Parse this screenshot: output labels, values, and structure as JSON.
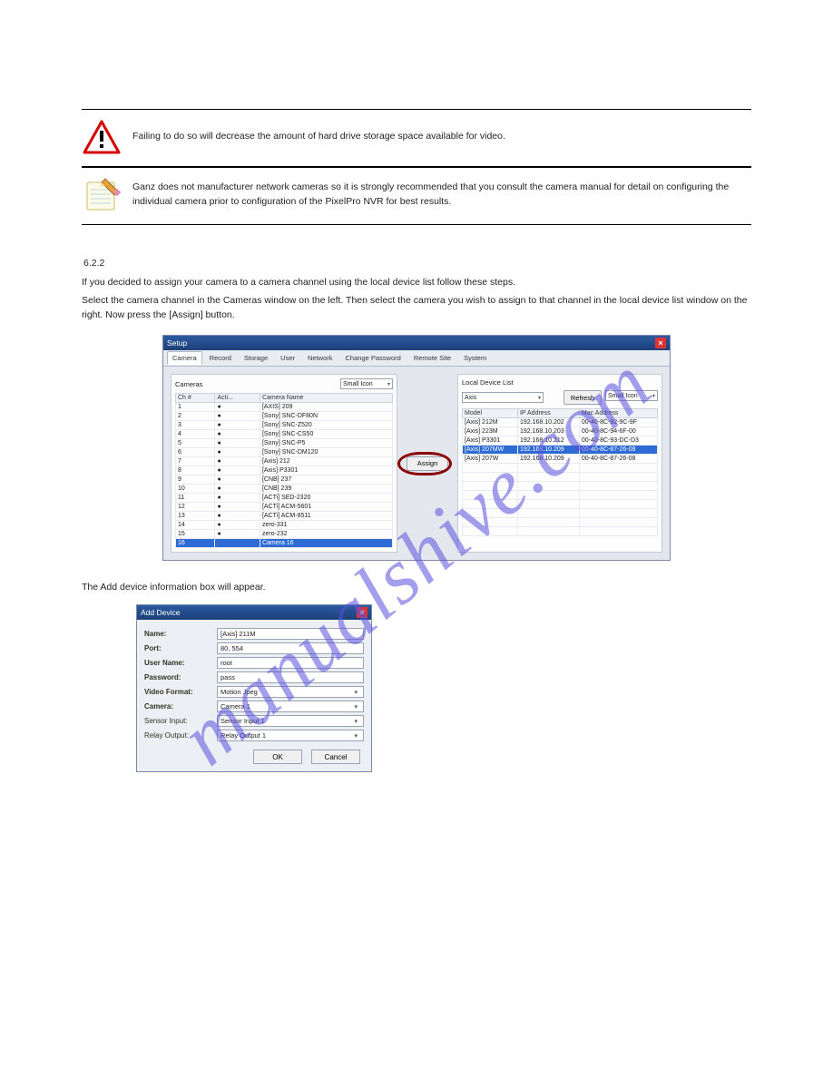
{
  "warning_box": {
    "text": "Failing to do so will decrease the amount of hard drive storage space available for video."
  },
  "note_box": {
    "text": "Ganz does not manufacturer network cameras so it is strongly recommended that you consult the camera manual for detail on configuring the individual camera prior to configuration of the PixelPro NVR for best results."
  },
  "watermark": "manualshive.com",
  "section": {
    "number": "6.2.2",
    "intro": "If you decided to assign your camera to a camera channel using the local device list follow these steps.",
    "step1": "Select the camera channel in the Cameras window on the left. Then select the camera you wish to assign to that channel in the local device list window on the right. Now press the [Assign] button.",
    "step2": "The Add device information box will appear."
  },
  "setup_window": {
    "title": "Setup",
    "tabs": [
      "Camera",
      "Record",
      "Storage",
      "User",
      "Network",
      "Change Password",
      "Remote Site",
      "System"
    ],
    "cameras_label": "Cameras",
    "view_mode": "Small Icon",
    "camera_cols": [
      "Ch #",
      "Acti...",
      "Camera Name"
    ],
    "camera_rows": [
      {
        "ch": "1",
        "a": "●",
        "name": "[AXIS] 209"
      },
      {
        "ch": "2",
        "a": "●",
        "name": "[Sony] SNC-DF80N"
      },
      {
        "ch": "3",
        "a": "●",
        "name": "[Sony] SNC-Z520"
      },
      {
        "ch": "4",
        "a": "●",
        "name": "[Sony] SNC-CS50"
      },
      {
        "ch": "5",
        "a": "●",
        "name": "[Sony] SNC-P5"
      },
      {
        "ch": "6",
        "a": "●",
        "name": "[Sony] SNC-DM120"
      },
      {
        "ch": "7",
        "a": "●",
        "name": "[Axis] 212"
      },
      {
        "ch": "8",
        "a": "●",
        "name": "[Axis] P3301"
      },
      {
        "ch": "9",
        "a": "●",
        "name": "[CNB] 237"
      },
      {
        "ch": "10",
        "a": "●",
        "name": "[CNB] 239"
      },
      {
        "ch": "11",
        "a": "●",
        "name": "[ACTi] SED-2320"
      },
      {
        "ch": "12",
        "a": "●",
        "name": "[ACTi] ACM-5601"
      },
      {
        "ch": "13",
        "a": "●",
        "name": "[ACTi] ACM-8511"
      },
      {
        "ch": "14",
        "a": "●",
        "name": "zero-331"
      },
      {
        "ch": "15",
        "a": "●",
        "name": "zero-232"
      },
      {
        "ch": "16",
        "a": "",
        "name": "Camera 16"
      }
    ],
    "ldl_label": "Local Device List",
    "filter": "Axis",
    "refresh": "Refresh",
    "ldl_view": "Small Icon",
    "ldl_cols": [
      "Model",
      "IP Address",
      "Mac Address"
    ],
    "ldl_rows": [
      {
        "m": "[Axis] 212M",
        "ip": "192.168.10.202",
        "mac": "00-40-8C-92-9C-9F"
      },
      {
        "m": "[Axis] 223M",
        "ip": "192.168.10.203",
        "mac": "00-40-8C-94-6F-00"
      },
      {
        "m": "[Axis] P3301",
        "ip": "192.168.10.212",
        "mac": "00-40-8C-93-DC-D3"
      },
      {
        "m": "[Axis] 207MW",
        "ip": "192.168.10.209",
        "mac": "00-40-8C-87-26-08"
      },
      {
        "m": "[Axis] 207W",
        "ip": "192.168.10.209",
        "mac": "00-40-8C-87-26-08"
      }
    ],
    "assign_label": "Assign"
  },
  "add_device": {
    "title": "Add Device",
    "fields": {
      "name_label": "Name:",
      "name_value": "[Axis] 211M",
      "port_label": "Port:",
      "port_value": "80, 554",
      "user_label": "User Name:",
      "user_value": "root",
      "pass_label": "Password:",
      "pass_value": "pass",
      "vfmt_label": "Video Format:",
      "vfmt_value": "Motion Jpeg",
      "cam_label": "Camera:",
      "cam_value": "Camera 1",
      "sin_label": "Sensor Input:",
      "sin_value": "Sensor Input 1",
      "rout_label": "Relay Output:",
      "rout_value": "Relay Output 1"
    },
    "ok": "OK",
    "cancel": "Cancel"
  }
}
